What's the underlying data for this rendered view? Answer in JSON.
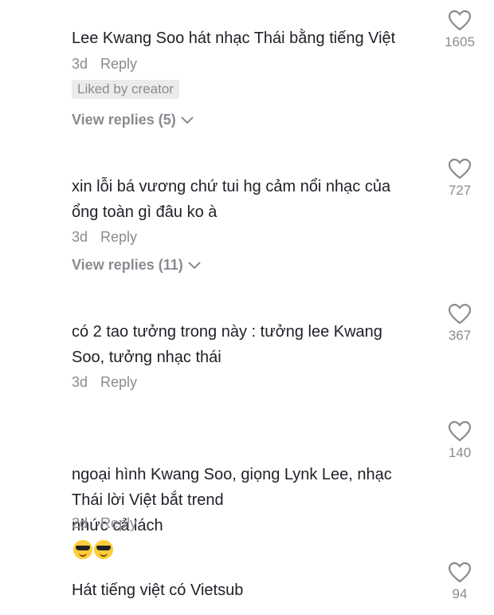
{
  "comments": [
    {
      "text": "Lee Kwang Soo hát nhạc Thái bằng tiếng Việt",
      "time": "3d",
      "reply_label": "Reply",
      "badge": "Liked by creator",
      "view_replies": "View replies (5)",
      "likes": "1605"
    },
    {
      "text": "xin lỗi bá vương chứ tui hg cảm nổi nhạc của\nổng toàn gì đâu ko à",
      "time": "3d",
      "reply_label": "Reply",
      "view_replies": "View replies (11)",
      "likes": "727"
    },
    {
      "text": "có 2 tao tưởng trong này : tưởng lee Kwang\nSoo, tưởng nhạc thái",
      "time": "3d",
      "reply_label": "Reply",
      "likes": "367"
    },
    {
      "text": "ngoại hình Kwang Soo, giọng Lynk Lee, nhạc\nThái lời Việt bắt trend\nnhức cả lách",
      "emoji": [
        "sunglasses-emoji",
        "sunglasses-emoji"
      ],
      "time": "2d",
      "reply_label": "Reply",
      "likes": "140"
    },
    {
      "text": "Hát tiếng việt có Vietsub",
      "likes": "94"
    }
  ],
  "colors": {
    "text": "#1f1f27",
    "muted": "#8a8b91",
    "badge_bg": "#ebebec"
  },
  "icons": {
    "like": "heart-outline-icon",
    "expand": "chevron-down-icon"
  }
}
